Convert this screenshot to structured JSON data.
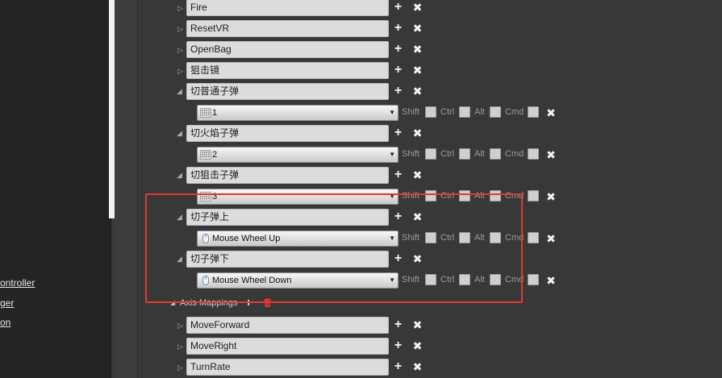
{
  "left_panel": {
    "items": [
      {
        "label": "ontroller"
      },
      {
        "label": "ger"
      },
      {
        "label": "on"
      }
    ]
  },
  "action_mappings": [
    {
      "name": "Fire",
      "expanded": false
    },
    {
      "name": "ResetVR",
      "expanded": false
    },
    {
      "name": "OpenBag",
      "expanded": false
    },
    {
      "name": "狙击镜",
      "expanded": false
    },
    {
      "name": "切普通子弹",
      "expanded": true,
      "key": "1",
      "key_type": "keyboard"
    },
    {
      "name": "切火焰子弹",
      "expanded": true,
      "key": "2",
      "key_type": "keyboard"
    },
    {
      "name": "切狙击子弹",
      "expanded": true,
      "key": "3",
      "key_type": "keyboard"
    },
    {
      "name": "切子弹上",
      "expanded": true,
      "key": "Mouse Wheel Up",
      "key_type": "mouse"
    },
    {
      "name": "切子弹下",
      "expanded": true,
      "key": "Mouse Wheel Down",
      "key_type": "mouse"
    }
  ],
  "modifiers": {
    "shift": "Shift",
    "ctrl": "Ctrl",
    "alt": "Alt",
    "cmd": "Cmd"
  },
  "axis_mappings": {
    "label": "Axis Mappings",
    "items": [
      {
        "name": "MoveForward"
      },
      {
        "name": "MoveRight"
      },
      {
        "name": "TurnRate"
      }
    ]
  },
  "icons": {
    "add": "plus-icon",
    "remove": "x-icon",
    "keyboard": "keyboard-icon",
    "mouse": "mouse-icon",
    "trash": "trash-icon"
  },
  "colors": {
    "highlight": "#e03a32",
    "background": "#383838",
    "field": "#dcdcdc"
  }
}
